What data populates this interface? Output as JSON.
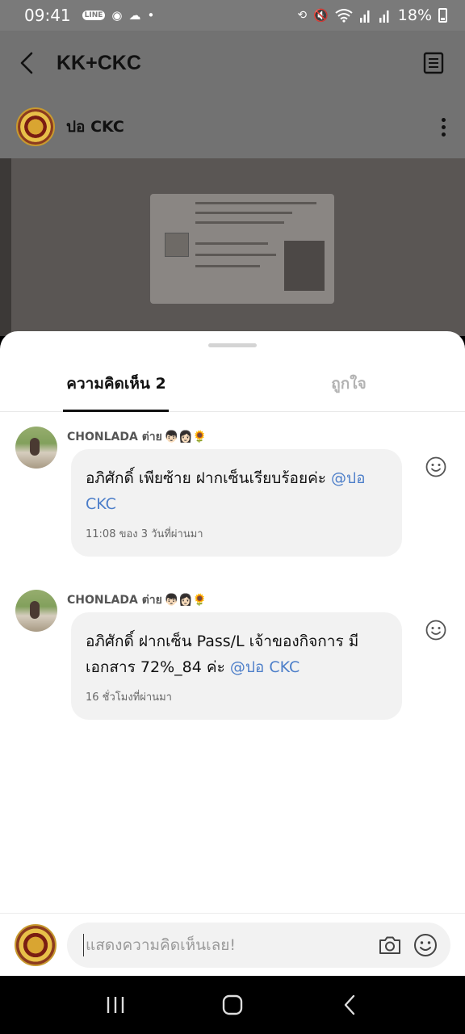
{
  "status_bar": {
    "time": "09:41",
    "app_icons": [
      "line-icon",
      "chrome-icon",
      "cloud-icon",
      "dot-icon"
    ],
    "right_icons": [
      "sync-icon",
      "mute-icon",
      "wifi-icon",
      "signal-icon",
      "signal-icon"
    ],
    "line_badge": "LINE",
    "battery": "18%"
  },
  "header": {
    "title": "KK+CKC",
    "back_icon": "chevron-left-icon",
    "notes_icon": "notes-icon"
  },
  "post": {
    "author": "ปอ CKC"
  },
  "sheet": {
    "tabs": [
      {
        "label": "ความคิดเห็น 2",
        "active": true
      },
      {
        "label": "ถูกใจ",
        "active": false
      }
    ],
    "comments": [
      {
        "author": "CHONLADA ต่าย",
        "author_emoji": "👦🏻👩🏻🌻",
        "text": "อภิศักดิ์ เพียซ้าย ฝากเซ็นเรียบร้อยค่ะ ",
        "mention": "@ปอ CKC",
        "time": "11:08 ของ 3 วันที่ผ่านมา"
      },
      {
        "author": "CHONLADA ต่าย",
        "author_emoji": "👦🏻👩🏻🌻",
        "text": "อภิศักดิ์ ฝากเซ็น Pass/L เจ้าของกิจการ มีเอกสาร  72%_84 ค่ะ ",
        "mention": "@ปอ CKC",
        "time": "16 ชั่วโมงที่ผ่านมา"
      }
    ]
  },
  "input": {
    "placeholder": "แสดงความคิดเห็นเลย!",
    "camera_icon": "camera-icon",
    "emoji_icon": "smile-icon"
  },
  "nav": [
    "recents-icon",
    "home-icon",
    "back-icon"
  ]
}
